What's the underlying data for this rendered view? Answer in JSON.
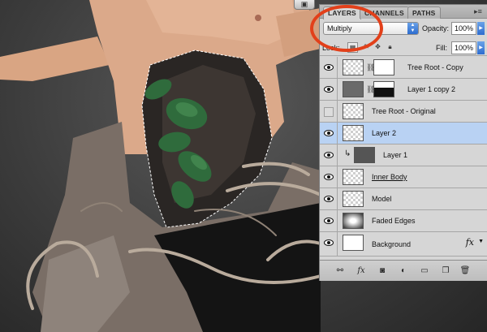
{
  "panel": {
    "tabs": [
      {
        "label": "LAYERS",
        "active": true
      },
      {
        "label": "CHANNELS",
        "active": false
      },
      {
        "label": "PATHS",
        "active": false
      }
    ],
    "menu_icon": "panel-menu-icon",
    "blend_mode": "Multiply",
    "opacity_label": "Opacity:",
    "opacity_value": "100%",
    "lock_label": "Lock:",
    "fill_label": "Fill:",
    "fill_value": "100%"
  },
  "layers": [
    {
      "name": "Tree Root - Copy",
      "visible": true,
      "has_mask": true,
      "selected": false
    },
    {
      "name": "Layer 1 copy 2",
      "visible": true,
      "has_mask": true,
      "selected": false
    },
    {
      "name": "Tree Root - Original",
      "visible": false,
      "has_mask": false,
      "selected": false
    },
    {
      "name": "Layer 2",
      "visible": true,
      "has_mask": false,
      "selected": true
    },
    {
      "name": "Layer 1",
      "visible": true,
      "has_mask": false,
      "selected": false,
      "clipped": true
    },
    {
      "name": "Inner Body",
      "visible": true,
      "has_mask": false,
      "selected": false
    },
    {
      "name": "Model",
      "visible": true,
      "has_mask": false,
      "selected": false
    },
    {
      "name": "Faded Edges",
      "visible": true,
      "has_mask": false,
      "selected": false
    },
    {
      "name": "Background",
      "visible": true,
      "has_mask": false,
      "selected": false,
      "has_fx": true
    }
  ],
  "fx_label": "fx",
  "bottom_icons": [
    "link-icon",
    "fx-icon",
    "mask-icon",
    "adjustment-icon",
    "group-folder-icon",
    "new-layer-icon",
    "trash-icon"
  ],
  "colors": {
    "highlight": "#e2401a",
    "selected_row": "#b9d2f3",
    "accent_blue": "#2d6ccf"
  }
}
